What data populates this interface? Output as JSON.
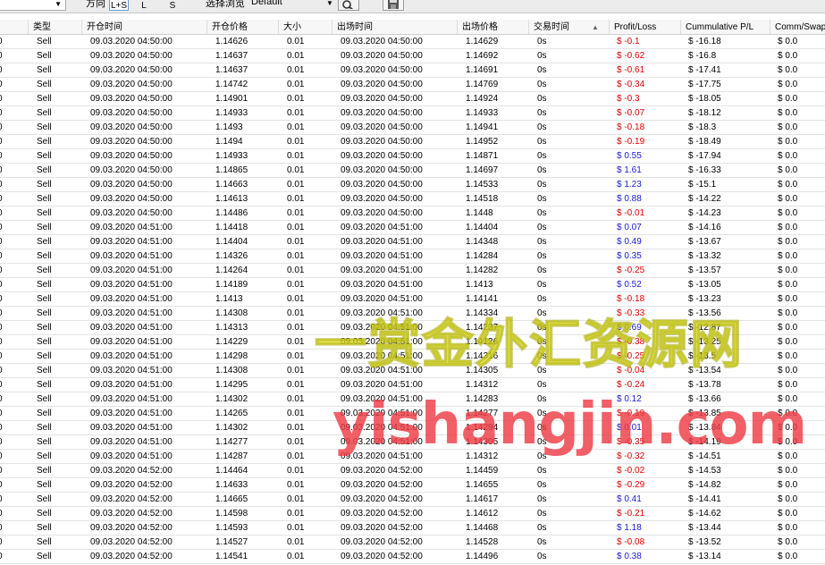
{
  "toolbar": {
    "direction_label": "方向",
    "direction_options": [
      "L+S",
      "L",
      "S"
    ],
    "view_label": "选择浏览",
    "view_value": "Default"
  },
  "columns": [
    "类型",
    "开仓时间",
    "开仓价格",
    "大小",
    "出场时间",
    "出场价格",
    "交易时间",
    "Profit/Loss",
    "Cummulative P/L",
    "Comm/Swap"
  ],
  "rows": [
    {
      "lead": "0",
      "type": "Sell",
      "open_time": "09.03.2020 04:50:00",
      "open_price": "1.14626",
      "size": "0.01",
      "exit_time": "09.03.2020 04:50:00",
      "exit_price": "1.14629",
      "duration": "0s",
      "pl": "$ -0.1",
      "cum": "$ -16.18",
      "comm": "$ 0.0"
    },
    {
      "lead": "0",
      "type": "Sell",
      "open_time": "09.03.2020 04:50:00",
      "open_price": "1.14637",
      "size": "0.01",
      "exit_time": "09.03.2020 04:50:00",
      "exit_price": "1.14692",
      "duration": "0s",
      "pl": "$ -0.62",
      "cum": "$ -16.8",
      "comm": "$ 0.0"
    },
    {
      "lead": "0",
      "type": "Sell",
      "open_time": "09.03.2020 04:50:00",
      "open_price": "1.14637",
      "size": "0.01",
      "exit_time": "09.03.2020 04:50:00",
      "exit_price": "1.14691",
      "duration": "0s",
      "pl": "$ -0.61",
      "cum": "$ -17.41",
      "comm": "$ 0.0"
    },
    {
      "lead": "0",
      "type": "Sell",
      "open_time": "09.03.2020 04:50:00",
      "open_price": "1.14742",
      "size": "0.01",
      "exit_time": "09.03.2020 04:50:00",
      "exit_price": "1.14769",
      "duration": "0s",
      "pl": "$ -0.34",
      "cum": "$ -17.75",
      "comm": "$ 0.0"
    },
    {
      "lead": "0",
      "type": "Sell",
      "open_time": "09.03.2020 04:50:00",
      "open_price": "1.14901",
      "size": "0.01",
      "exit_time": "09.03.2020 04:50:00",
      "exit_price": "1.14924",
      "duration": "0s",
      "pl": "$ -0.3",
      "cum": "$ -18.05",
      "comm": "$ 0.0"
    },
    {
      "lead": "0",
      "type": "Sell",
      "open_time": "09.03.2020 04:50:00",
      "open_price": "1.14933",
      "size": "0.01",
      "exit_time": "09.03.2020 04:50:00",
      "exit_price": "1.14933",
      "duration": "0s",
      "pl": "$ -0.07",
      "cum": "$ -18.12",
      "comm": "$ 0.0"
    },
    {
      "lead": "0",
      "type": "Sell",
      "open_time": "09.03.2020 04:50:00",
      "open_price": "1.1493",
      "size": "0.01",
      "exit_time": "09.03.2020 04:50:00",
      "exit_price": "1.14941",
      "duration": "0s",
      "pl": "$ -0.18",
      "cum": "$ -18.3",
      "comm": "$ 0.0"
    },
    {
      "lead": "0",
      "type": "Sell",
      "open_time": "09.03.2020 04:50:00",
      "open_price": "1.1494",
      "size": "0.01",
      "exit_time": "09.03.2020 04:50:00",
      "exit_price": "1.14952",
      "duration": "0s",
      "pl": "$ -0.19",
      "cum": "$ -18.49",
      "comm": "$ 0.0"
    },
    {
      "lead": "0",
      "type": "Sell",
      "open_time": "09.03.2020 04:50:00",
      "open_price": "1.14933",
      "size": "0.01",
      "exit_time": "09.03.2020 04:50:00",
      "exit_price": "1.14871",
      "duration": "0s",
      "pl": "$ 0.55",
      "cum": "$ -17.94",
      "comm": "$ 0.0"
    },
    {
      "lead": "0",
      "type": "Sell",
      "open_time": "09.03.2020 04:50:00",
      "open_price": "1.14865",
      "size": "0.01",
      "exit_time": "09.03.2020 04:50:00",
      "exit_price": "1.14697",
      "duration": "0s",
      "pl": "$ 1.61",
      "cum": "$ -16.33",
      "comm": "$ 0.0"
    },
    {
      "lead": "0",
      "type": "Sell",
      "open_time": "09.03.2020 04:50:00",
      "open_price": "1.14663",
      "size": "0.01",
      "exit_time": "09.03.2020 04:50:00",
      "exit_price": "1.14533",
      "duration": "0s",
      "pl": "$ 1.23",
      "cum": "$ -15.1",
      "comm": "$ 0.0"
    },
    {
      "lead": "0",
      "type": "Sell",
      "open_time": "09.03.2020 04:50:00",
      "open_price": "1.14613",
      "size": "0.01",
      "exit_time": "09.03.2020 04:50:00",
      "exit_price": "1.14518",
      "duration": "0s",
      "pl": "$ 0.88",
      "cum": "$ -14.22",
      "comm": "$ 0.0"
    },
    {
      "lead": "0",
      "type": "Sell",
      "open_time": "09.03.2020 04:50:00",
      "open_price": "1.14486",
      "size": "0.01",
      "exit_time": "09.03.2020 04:50:00",
      "exit_price": "1.1448",
      "duration": "0s",
      "pl": "$ -0.01",
      "cum": "$ -14.23",
      "comm": "$ 0.0"
    },
    {
      "lead": "0",
      "type": "Sell",
      "open_time": "09.03.2020 04:51:00",
      "open_price": "1.14418",
      "size": "0.01",
      "exit_time": "09.03.2020 04:51:00",
      "exit_price": "1.14404",
      "duration": "0s",
      "pl": "$ 0.07",
      "cum": "$ -14.16",
      "comm": "$ 0.0"
    },
    {
      "lead": "0",
      "type": "Sell",
      "open_time": "09.03.2020 04:51:00",
      "open_price": "1.14404",
      "size": "0.01",
      "exit_time": "09.03.2020 04:51:00",
      "exit_price": "1.14348",
      "duration": "0s",
      "pl": "$ 0.49",
      "cum": "$ -13.67",
      "comm": "$ 0.0"
    },
    {
      "lead": "0",
      "type": "Sell",
      "open_time": "09.03.2020 04:51:00",
      "open_price": "1.14326",
      "size": "0.01",
      "exit_time": "09.03.2020 04:51:00",
      "exit_price": "1.14284",
      "duration": "0s",
      "pl": "$ 0.35",
      "cum": "$ -13.32",
      "comm": "$ 0.0"
    },
    {
      "lead": "0",
      "type": "Sell",
      "open_time": "09.03.2020 04:51:00",
      "open_price": "1.14264",
      "size": "0.01",
      "exit_time": "09.03.2020 04:51:00",
      "exit_price": "1.14282",
      "duration": "0s",
      "pl": "$ -0.25",
      "cum": "$ -13.57",
      "comm": "$ 0.0"
    },
    {
      "lead": "0",
      "type": "Sell",
      "open_time": "09.03.2020 04:51:00",
      "open_price": "1.14189",
      "size": "0.01",
      "exit_time": "09.03.2020 04:51:00",
      "exit_price": "1.1413",
      "duration": "0s",
      "pl": "$ 0.52",
      "cum": "$ -13.05",
      "comm": "$ 0.0"
    },
    {
      "lead": "0",
      "type": "Sell",
      "open_time": "09.03.2020 04:51:00",
      "open_price": "1.1413",
      "size": "0.01",
      "exit_time": "09.03.2020 04:51:00",
      "exit_price": "1.14141",
      "duration": "0s",
      "pl": "$ -0.18",
      "cum": "$ -13.23",
      "comm": "$ 0.0"
    },
    {
      "lead": "0",
      "type": "Sell",
      "open_time": "09.03.2020 04:51:00",
      "open_price": "1.14308",
      "size": "0.01",
      "exit_time": "09.03.2020 04:51:00",
      "exit_price": "1.14334",
      "duration": "0s",
      "pl": "$ -0.33",
      "cum": "$ -13.56",
      "comm": "$ 0.0"
    },
    {
      "lead": "0",
      "type": "Sell",
      "open_time": "09.03.2020 04:51:00",
      "open_price": "1.14313",
      "size": "0.01",
      "exit_time": "09.03.2020 04:51:00",
      "exit_price": "1.14237",
      "duration": "0s",
      "pl": "$ 0.69",
      "cum": "$ -12.87",
      "comm": "$ 0.0"
    },
    {
      "lead": "0",
      "type": "Sell",
      "open_time": "09.03.2020 04:51:00",
      "open_price": "1.14229",
      "size": "0.01",
      "exit_time": "09.03.2020 04:51:00",
      "exit_price": "1.14126",
      "duration": "0s",
      "pl": "$ -0.38",
      "cum": "$ -13.25",
      "comm": "$ 0.0"
    },
    {
      "lead": "0",
      "type": "Sell",
      "open_time": "09.03.2020 04:51:00",
      "open_price": "1.14298",
      "size": "0.01",
      "exit_time": "09.03.2020 04:51:00",
      "exit_price": "1.14316",
      "duration": "0s",
      "pl": "$ -0.25",
      "cum": "$ -13.5",
      "comm": "$ 0.0"
    },
    {
      "lead": "0",
      "type": "Sell",
      "open_time": "09.03.2020 04:51:00",
      "open_price": "1.14308",
      "size": "0.01",
      "exit_time": "09.03.2020 04:51:00",
      "exit_price": "1.14305",
      "duration": "0s",
      "pl": "$ -0.04",
      "cum": "$ -13.54",
      "comm": "$ 0.0"
    },
    {
      "lead": "0",
      "type": "Sell",
      "open_time": "09.03.2020 04:51:00",
      "open_price": "1.14295",
      "size": "0.01",
      "exit_time": "09.03.2020 04:51:00",
      "exit_price": "1.14312",
      "duration": "0s",
      "pl": "$ -0.24",
      "cum": "$ -13.78",
      "comm": "$ 0.0"
    },
    {
      "lead": "0",
      "type": "Sell",
      "open_time": "09.03.2020 04:51:00",
      "open_price": "1.14302",
      "size": "0.01",
      "exit_time": "09.03.2020 04:51:00",
      "exit_price": "1.14283",
      "duration": "0s",
      "pl": "$ 0.12",
      "cum": "$ -13.66",
      "comm": "$ 0.0"
    },
    {
      "lead": "0",
      "type": "Sell",
      "open_time": "09.03.2020 04:51:00",
      "open_price": "1.14265",
      "size": "0.01",
      "exit_time": "09.03.2020 04:51:00",
      "exit_price": "1.14277",
      "duration": "0s",
      "pl": "$ -0.19",
      "cum": "$ -13.85",
      "comm": "$ 0.0"
    },
    {
      "lead": "0",
      "type": "Sell",
      "open_time": "09.03.2020 04:51:00",
      "open_price": "1.14302",
      "size": "0.01",
      "exit_time": "09.03.2020 04:51:00",
      "exit_price": "1.14294",
      "duration": "0s",
      "pl": "$ 0.01",
      "cum": "$ -13.84",
      "comm": "$ 0.0"
    },
    {
      "lead": "0",
      "type": "Sell",
      "open_time": "09.03.2020 04:51:00",
      "open_price": "1.14277",
      "size": "0.01",
      "exit_time": "09.03.2020 04:51:00",
      "exit_price": "1.14305",
      "duration": "0s",
      "pl": "$ -0.35",
      "cum": "$ -14.19",
      "comm": "$ 0.0"
    },
    {
      "lead": "0",
      "type": "Sell",
      "open_time": "09.03.2020 04:51:00",
      "open_price": "1.14287",
      "size": "0.01",
      "exit_time": "09.03.2020 04:51:00",
      "exit_price": "1.14312",
      "duration": "0s",
      "pl": "$ -0.32",
      "cum": "$ -14.51",
      "comm": "$ 0.0"
    },
    {
      "lead": "0",
      "type": "Sell",
      "open_time": "09.03.2020 04:52:00",
      "open_price": "1.14464",
      "size": "0.01",
      "exit_time": "09.03.2020 04:52:00",
      "exit_price": "1.14459",
      "duration": "0s",
      "pl": "$ -0.02",
      "cum": "$ -14.53",
      "comm": "$ 0.0"
    },
    {
      "lead": "0",
      "type": "Sell",
      "open_time": "09.03.2020 04:52:00",
      "open_price": "1.14633",
      "size": "0.01",
      "exit_time": "09.03.2020 04:52:00",
      "exit_price": "1.14655",
      "duration": "0s",
      "pl": "$ -0.29",
      "cum": "$ -14.82",
      "comm": "$ 0.0"
    },
    {
      "lead": "0",
      "type": "Sell",
      "open_time": "09.03.2020 04:52:00",
      "open_price": "1.14665",
      "size": "0.01",
      "exit_time": "09.03.2020 04:52:00",
      "exit_price": "1.14617",
      "duration": "0s",
      "pl": "$ 0.41",
      "cum": "$ -14.41",
      "comm": "$ 0.0"
    },
    {
      "lead": "0",
      "type": "Sell",
      "open_time": "09.03.2020 04:52:00",
      "open_price": "1.14598",
      "size": "0.01",
      "exit_time": "09.03.2020 04:52:00",
      "exit_price": "1.14612",
      "duration": "0s",
      "pl": "$ -0.21",
      "cum": "$ -14.62",
      "comm": "$ 0.0"
    },
    {
      "lead": "0",
      "type": "Sell",
      "open_time": "09.03.2020 04:52:00",
      "open_price": "1.14593",
      "size": "0.01",
      "exit_time": "09.03.2020 04:52:00",
      "exit_price": "1.14468",
      "duration": "0s",
      "pl": "$ 1.18",
      "cum": "$ -13.44",
      "comm": "$ 0.0"
    },
    {
      "lead": "0",
      "type": "Sell",
      "open_time": "09.03.2020 04:52:00",
      "open_price": "1.14527",
      "size": "0.01",
      "exit_time": "09.03.2020 04:52:00",
      "exit_price": "1.14528",
      "duration": "0s",
      "pl": "$ -0.08",
      "cum": "$ -13.52",
      "comm": "$ 0.0"
    },
    {
      "lead": "0",
      "type": "Sell",
      "open_time": "09.03.2020 04:52:00",
      "open_price": "1.14541",
      "size": "0.01",
      "exit_time": "09.03.2020 04:52:00",
      "exit_price": "1.14496",
      "duration": "0s",
      "pl": "$ 0.38",
      "cum": "$ -13.14",
      "comm": "$ 0.0"
    }
  ],
  "watermark": {
    "line1": "一赏金外汇资源网",
    "line2": "yishangjin.com"
  },
  "colors": {
    "loss": "#e00000",
    "profit": "#1a1ad8"
  },
  "icons": {
    "search": "magnifier-icon",
    "save": "floppy-disk-icon",
    "sort": "sort-asc-icon"
  }
}
